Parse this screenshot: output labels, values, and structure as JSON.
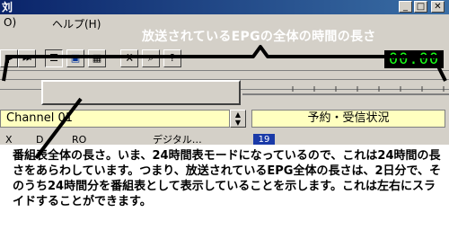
{
  "window": {
    "title_fragment": "刘",
    "buttons": {
      "minimize": "_",
      "maximize": "□",
      "close": "✕"
    }
  },
  "menu": {
    "items": [
      {
        "label": "O)"
      },
      {
        "label": "ヘルプ(H)"
      }
    ]
  },
  "annotations": {
    "top_callout": "放送されているEPGの全体の時間の長さ",
    "bottom_callout": "番組表全体の長さ。いま、24時間表モードになっているので、これは24時間の長さをあらわしています。つまり、放送されているEPG全体の長さは、2日分で、そのうち24時間分を番組表として表示していることを示します。これは左右にスライドすることができます。"
  },
  "toolbar": {
    "buttons": [
      {
        "icon": "play-icon"
      },
      {
        "icon": "skip-end-icon"
      },
      {
        "icon": "database-icon"
      },
      {
        "icon": "window-icon"
      },
      {
        "icon": "grid-icon"
      },
      {
        "icon": "tool-icon"
      },
      {
        "icon": "search-icon"
      },
      {
        "icon": "help-icon"
      }
    ],
    "clock": "00:00"
  },
  "timeline": {
    "visible_fraction": 0.5
  },
  "channel_bar": {
    "channel_label": "Channel  01",
    "status_button": "予約・受信状況"
  },
  "list": {
    "cells": [
      "X",
      "D",
      "RO",
      "デジタル…",
      "19"
    ]
  },
  "colors": {
    "face": "#d4d0c8",
    "clock_text": "#18ff18",
    "field_bg": "#ffffc0",
    "title_bar": "#0a246a"
  }
}
